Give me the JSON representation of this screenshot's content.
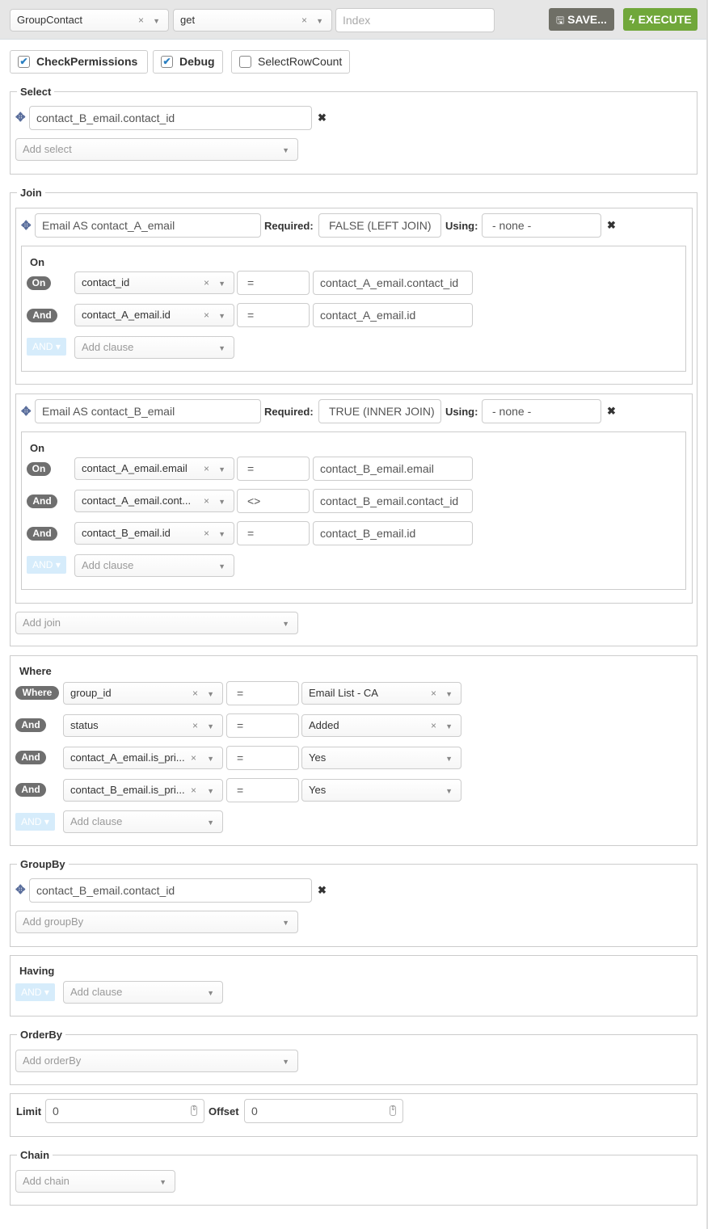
{
  "topbar": {
    "entity": "GroupContact",
    "action": "get",
    "index_placeholder": "Index",
    "save_label": "SAVE...",
    "execute_label": "EXECUTE",
    "save_color": "#6f6f66",
    "execute_color": "#70a73a"
  },
  "options": [
    {
      "label": "CheckPermissions",
      "checked": true,
      "mark": "✔"
    },
    {
      "label": "Debug",
      "checked": true,
      "mark": "✔"
    },
    {
      "label": "SelectRowCount",
      "checked": false,
      "mark": ""
    }
  ],
  "select": {
    "legend": "Select",
    "items": [
      "contact_B_email.contact_id"
    ],
    "add_placeholder": "Add select"
  },
  "join": {
    "legend": "Join",
    "required_label": "Required:",
    "using_label": "Using:",
    "on_legend": "On",
    "and_button": "AND",
    "add_clause": "Add clause",
    "joins": [
      {
        "entity": "Email AS contact_A_email",
        "required": "FALSE (LEFT JOIN)",
        "using": "- none -",
        "clauses": [
          {
            "conj": "On",
            "field": "contact_id",
            "op": "=",
            "value": "contact_A_email.contact_id"
          },
          {
            "conj": "And",
            "field": "contact_A_email.id",
            "op": "=",
            "value": "contact_A_email.id"
          }
        ]
      },
      {
        "entity": "Email AS contact_B_email",
        "required": "TRUE (INNER JOIN)",
        "using": "- none -",
        "clauses": [
          {
            "conj": "On",
            "field": "contact_A_email.email",
            "op": "=",
            "value": "contact_B_email.email"
          },
          {
            "conj": "And",
            "field": "contact_A_email.cont...",
            "op": "<>",
            "value": "contact_B_email.contact_id"
          },
          {
            "conj": "And",
            "field": "contact_B_email.id",
            "op": "=",
            "value": "contact_B_email.id"
          }
        ]
      }
    ],
    "add_placeholder": "Add join"
  },
  "where": {
    "legend": "Where",
    "clauses": [
      {
        "conj": "Where",
        "field": "group_id",
        "op": "=",
        "value": "Email List - CA",
        "clearable": true
      },
      {
        "conj": "And",
        "field": "status",
        "op": "=",
        "value": "Added",
        "clearable": true
      },
      {
        "conj": "And",
        "field": "contact_A_email.is_pri...",
        "op": "=",
        "value": "Yes",
        "clearable": false
      },
      {
        "conj": "And",
        "field": "contact_B_email.is_pri...",
        "op": "=",
        "value": "Yes",
        "clearable": false
      }
    ],
    "and_button": "AND",
    "add_clause": "Add clause"
  },
  "groupby": {
    "legend": "GroupBy",
    "items": [
      "contact_B_email.contact_id"
    ],
    "add_placeholder": "Add groupBy"
  },
  "having": {
    "legend": "Having",
    "and_button": "AND",
    "add_clause": "Add clause"
  },
  "orderby": {
    "legend": "OrderBy",
    "add_placeholder": "Add orderBy"
  },
  "limit": {
    "limit_label": "Limit",
    "limit_value": "0",
    "offset_label": "Offset",
    "offset_value": "0"
  },
  "chain": {
    "legend": "Chain",
    "add_placeholder": "Add chain"
  },
  "icons": {
    "clear": "×",
    "arrow": "▼",
    "remove": "✖",
    "move": "✥",
    "save": "🖫",
    "bolt": "ϟ",
    "caret": "▾",
    "spin": "⇕"
  }
}
